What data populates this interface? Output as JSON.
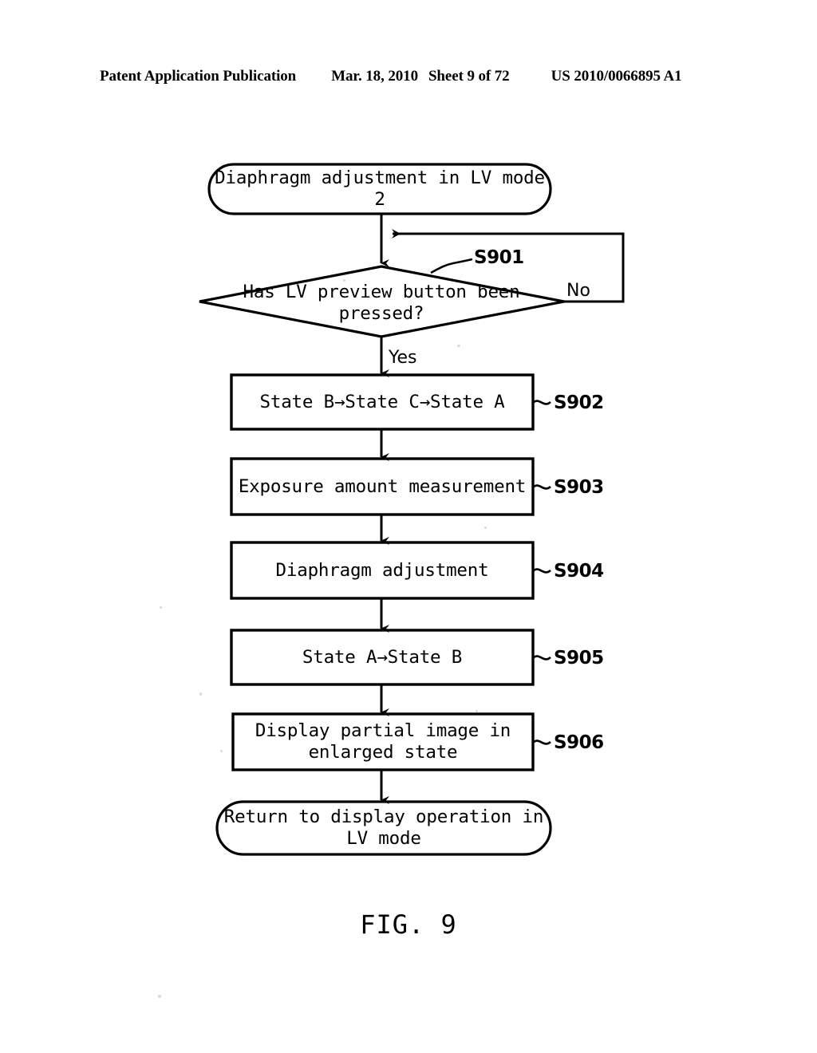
{
  "header": {
    "publication": "Patent Application Publication",
    "date": "Mar. 18, 2010",
    "sheet": "Sheet 9 of 72",
    "patent_number": "US 2010/0066895 A1"
  },
  "figure": {
    "caption": "FIG. 9",
    "nodes": {
      "start": "Diaphragm adjustment in LV mode 2",
      "decision": "Has LV preview button been\npressed?",
      "s902": "State B→State C→State A",
      "s903": "Exposure amount measurement",
      "s904": "Diaphragm adjustment",
      "s905": "State A→State B",
      "s906": "Display partial image in\nenlarged state",
      "end": "Return to display operation in\nLV mode"
    },
    "step_labels": {
      "s901": "S901",
      "s902": "S902",
      "s903": "S903",
      "s904": "S904",
      "s905": "S905",
      "s906": "S906"
    },
    "branch_labels": {
      "yes": "Yes",
      "no": "No"
    }
  },
  "colors": {
    "ink": "#000000",
    "paper": "#ffffff"
  }
}
